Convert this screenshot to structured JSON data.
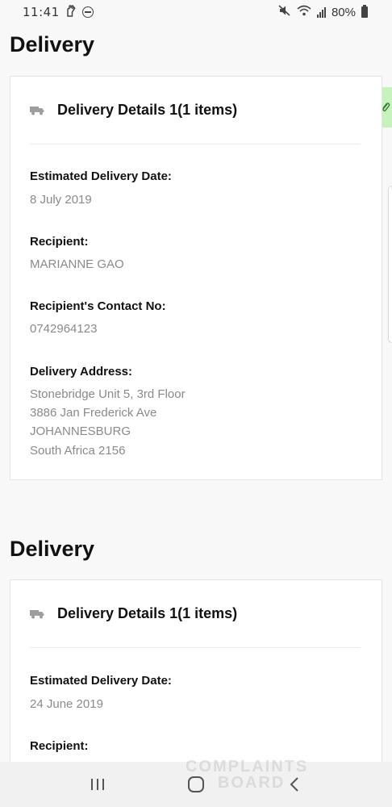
{
  "status_bar": {
    "time": "11:41",
    "battery": "80%"
  },
  "deliveries": [
    {
      "section_title": "Delivery",
      "card_title": "Delivery Details 1(1 items)",
      "fields": {
        "estimated_date_label": "Estimated Delivery Date:",
        "estimated_date": "8 July 2019",
        "recipient_label": "Recipient:",
        "recipient": "MARIANNE GAO",
        "contact_label": "Recipient's Contact No:",
        "contact": "0742964123",
        "address_label": "Delivery Address:",
        "address_lines": [
          "Stonebridge Unit 5, 3rd Floor",
          "3886 Jan Frederick Ave",
          "JOHANNESBURG",
          "South Africa 2156"
        ]
      }
    },
    {
      "section_title": "Delivery",
      "card_title": "Delivery Details 1(1 items)",
      "fields": {
        "estimated_date_label": "Estimated Delivery Date:",
        "estimated_date": "24 June 2019",
        "recipient_label": "Recipient:"
      }
    }
  ],
  "watermark": {
    "line1": "COMPLAINTS",
    "line2": "BOARD"
  },
  "icons": {
    "truck": "truck-icon",
    "paperclip": "paperclip-icon",
    "recents": "recents-icon",
    "home": "home-icon",
    "back": "back-icon"
  },
  "colors": {
    "side_tab": "#c8f2bd",
    "value_text": "#8a8a8a"
  }
}
